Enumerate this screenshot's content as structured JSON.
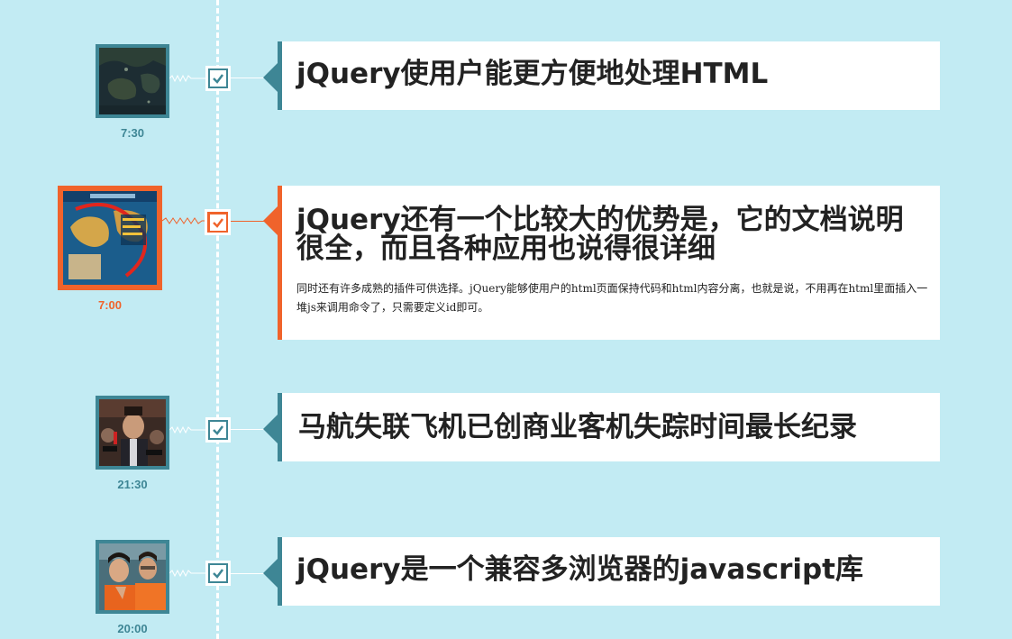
{
  "theme": {
    "background": "#c2ebf3",
    "accent": "#3e8695",
    "active_accent": "#f0632b"
  },
  "timeline": {
    "items": [
      {
        "time": "7:30",
        "title": "jQuery使用户能更方便地处理HTML",
        "description": "",
        "active": false,
        "photo": "satellite-map-photo"
      },
      {
        "time": "7:00",
        "title": "jQuery还有一个比较大的优势是，它的文档说明很全，而且各种应用也说得很详细",
        "description": "同时还有许多成熟的插件可供选择。jQuery能够使用户的html页面保持代码和html内容分离，也就是说，不用再在html里面插入一堆js来调用命令了，只需要定义id即可。",
        "active": true,
        "photo": "flight-route-map-photo"
      },
      {
        "time": "21:30",
        "title": "马航失联飞机已创商业客机失踪时间最长纪录",
        "description": "",
        "active": false,
        "photo": "press-conference-photo"
      },
      {
        "time": "20:00",
        "title": "jQuery是一个兼容多浏览器的javascript库",
        "description": "",
        "active": false,
        "photo": "praying-people-photo"
      }
    ]
  }
}
